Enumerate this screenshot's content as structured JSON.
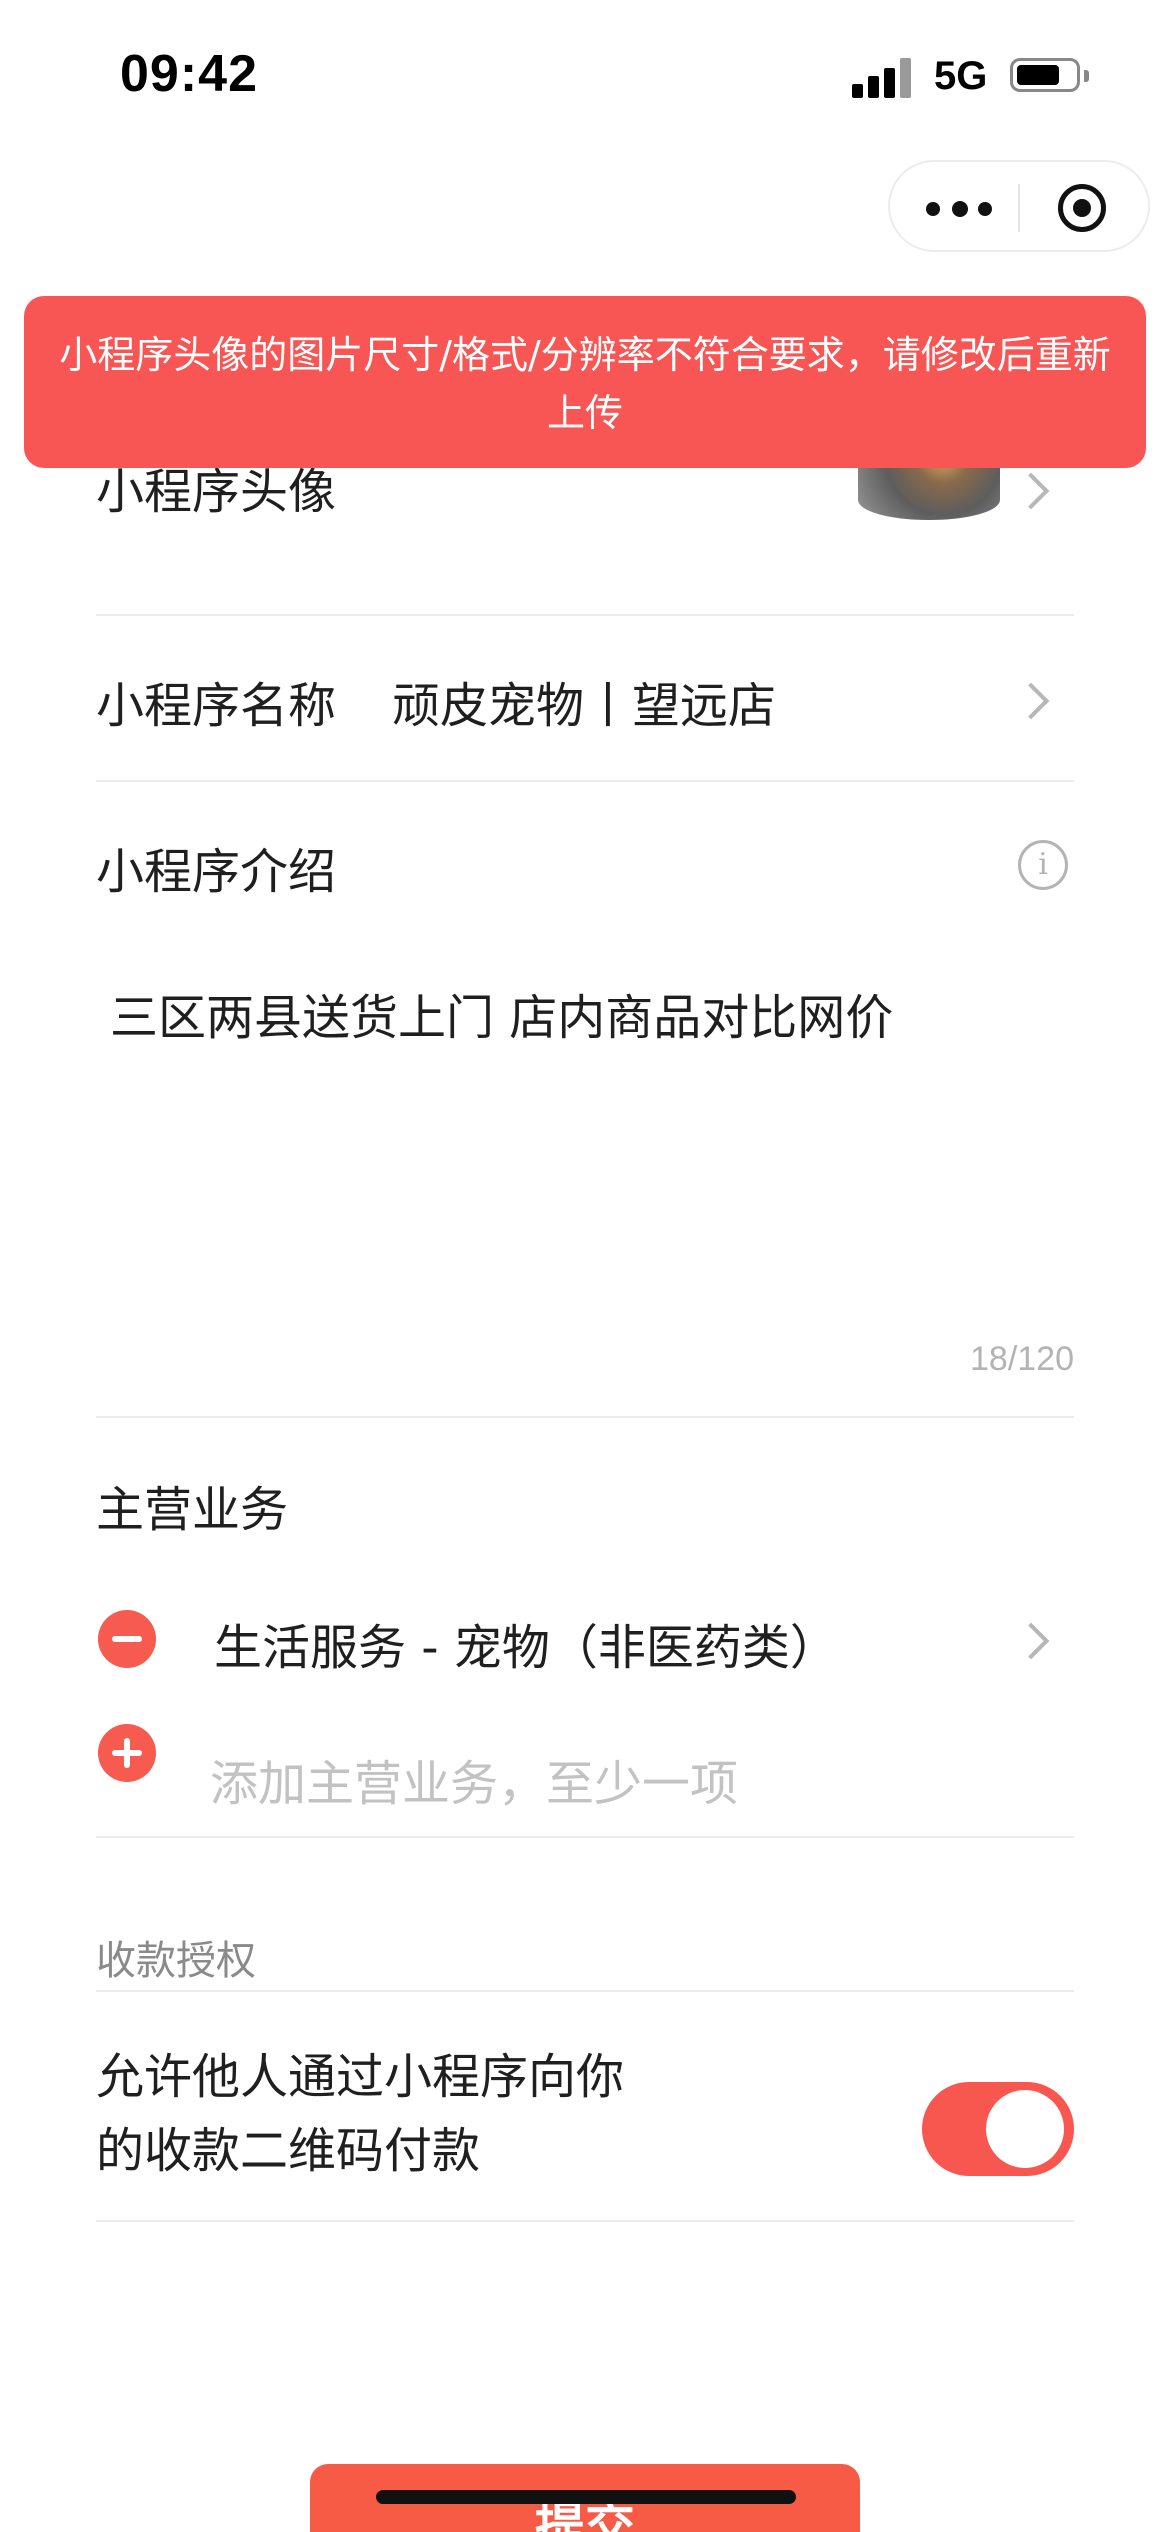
{
  "status_bar": {
    "time": "09:42",
    "network": "5G",
    "battery_level": 0.75
  },
  "toast": {
    "message": "小程序头像的图片尺寸/格式/分辨率不符合要求，请修改后重新上传"
  },
  "avatar_row": {
    "label": "小程序头像"
  },
  "name_row": {
    "label": "小程序名称",
    "value": "顽皮宠物丨望远店"
  },
  "intro": {
    "label": "小程序介绍",
    "text": "三区两县送货上门 店内商品对比网价",
    "counter": "18/120"
  },
  "business": {
    "label": "主营业务",
    "items": [
      {
        "text": "生活服务 - 宠物（非医药类）"
      }
    ],
    "add_placeholder": "添加主营业务，至少一项"
  },
  "payment": {
    "section_label": "收款授权",
    "line1": "允许他人通过小程序向你",
    "line2": "的收款二维码付款",
    "enabled": true
  },
  "submit": {
    "label": "提交"
  },
  "colors": {
    "accent": "#f75a4f",
    "toast_bg": "#f75654"
  }
}
